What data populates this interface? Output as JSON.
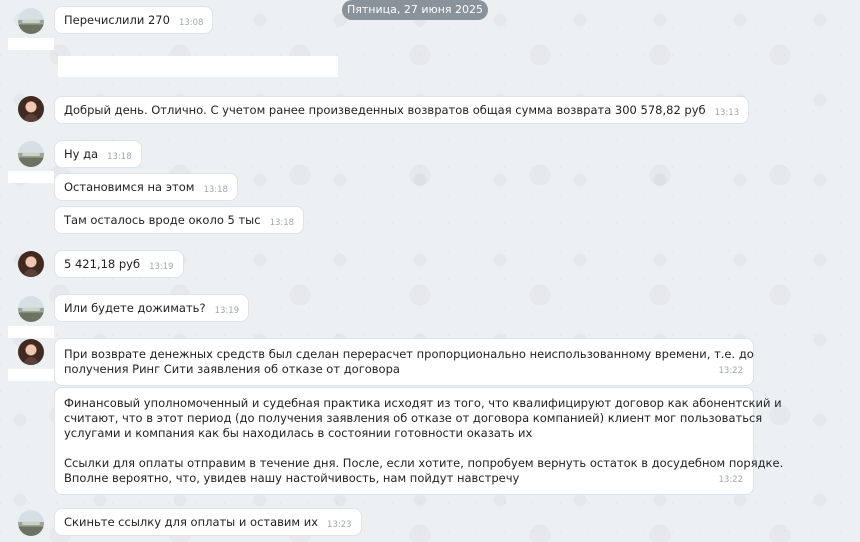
{
  "date_label": "Пятница, 27 июня 2025",
  "messages": [
    {
      "text": "Перечислили 270",
      "time": "13:08"
    },
    {
      "text": "Добрый день. Отлично. С учетом ранее произведенных возвратов общая сумма возврата 300 578,82 руб",
      "time": "13:13"
    },
    {
      "text": "Ну да",
      "time": "13:18"
    },
    {
      "text": "Остановимся на этом",
      "time": "13:18"
    },
    {
      "text": "Там осталось вроде около 5 тыс",
      "time": "13:18"
    },
    {
      "text": "5 421,18 руб",
      "time": "13:19"
    },
    {
      "text": "Или будете дожимать?",
      "time": "13:19"
    },
    {
      "lines": [
        "При возврате денежных средств был сделан перерасчет пропорционально неиспользованному времени, т.е. до",
        "получения Ринг Сити заявления об отказе от договора"
      ],
      "time": "13:22"
    },
    {
      "lines": [
        "Финансовый уполномоченный и судебная практика исходят из того, что квалифицируют договор как абонентский и",
        "считают, что в этот период (до получения заявления об отказе от договора компанией) клиент мог пользоваться",
        "услугами и компания как бы находилась в состоянии готовности оказать их",
        "",
        "Ссылки для оплаты отправим в течение дня. После, если хотите, попробуем вернуть остаток в досудебном порядке.",
        "Вполне вероятно, что, увидев нашу настойчивость, нам пойдут навстречу"
      ],
      "time": "13:22"
    },
    {
      "text": "Скиньте ссылку для оплаты и оставим их",
      "time": "13:23"
    }
  ]
}
